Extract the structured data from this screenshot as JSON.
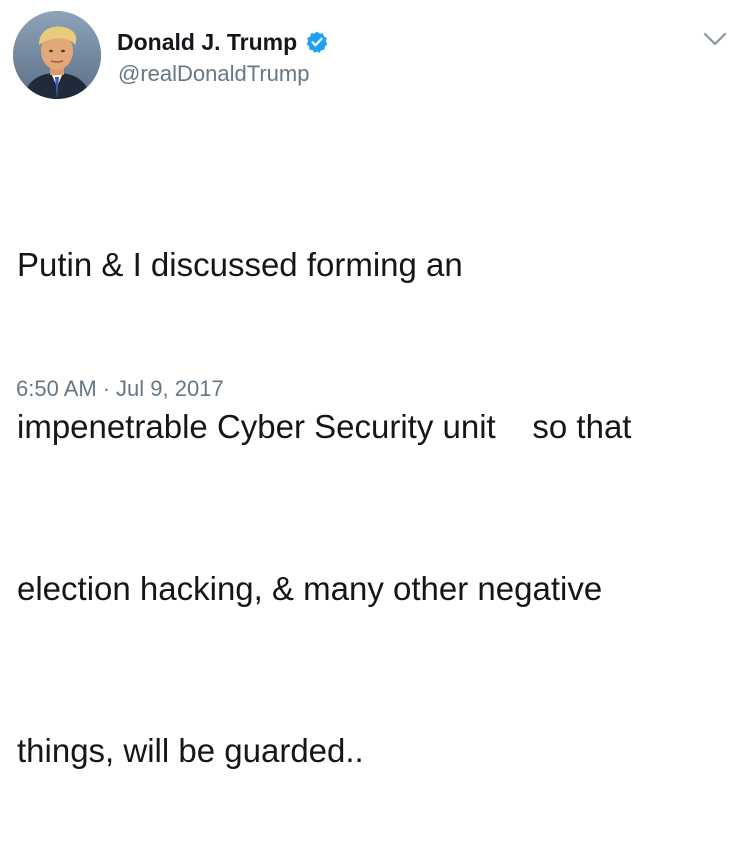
{
  "author": {
    "display_name": "Donald J. Trump",
    "handle": "@realDonaldTrump",
    "verified": true,
    "avatar_icon": "profile-photo",
    "verified_icon": "verified-badge-icon"
  },
  "tweet": {
    "lines": [
      "Putin & I discussed forming an",
      "impenetrable Cyber Security unit    so that",
      "election hacking, & many other negative",
      "things, will be guarded.."
    ],
    "time": "6:50 AM",
    "separator": "·",
    "date": "Jul 9, 2017"
  },
  "controls": {
    "menu_icon": "chevron-down-icon"
  },
  "colors": {
    "text": "#14171a",
    "secondary": "#657786",
    "verified": "#1da1f2",
    "chevron": "#8899a6"
  }
}
